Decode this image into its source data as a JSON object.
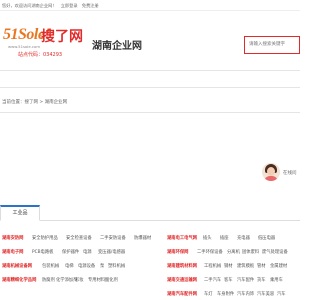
{
  "topbar": {
    "welcome": "您好，欢迎访问湖南企业网！",
    "login": "立即登录",
    "register": "免费注册"
  },
  "logo": {
    "brand": "51Sole!",
    "soso": "搜了网",
    "url": "www.51sole.com",
    "code_label": "站点代码：034293"
  },
  "site_title": "湖南企业网",
  "search": {
    "placeholder": "请输入搜索关键字"
  },
  "breadcrumb": "当前位置：搜了网 > 湖南企业网",
  "chat": {
    "label": "在线问"
  },
  "tabs": [
    {
      "label": "工业品"
    }
  ],
  "categories": [
    {
      "title": "湖南安防网",
      "items": [
        "安全防护用品",
        "安全检查设备",
        "二手安防设备",
        "防爆器材"
      ]
    },
    {
      "title": "湖南电子网",
      "items": [
        "PCB电路板",
        "保护器件",
        "电源",
        "变压器/电感器"
      ]
    },
    {
      "title": "湖南机械设备网",
      "items": [
        "包装机械",
        "电梯",
        "电源设备",
        "泵",
        "塑料机械"
      ]
    },
    {
      "title": "湖南精细化学品网",
      "items": [
        "防腐剂",
        "化学添加剂",
        "彩妆",
        "专用材料",
        "酸化剂"
      ]
    }
  ],
  "categories_right": [
    {
      "title": "湖南电工电气网",
      "items": [
        "插头",
        "插座",
        "充电器",
        "低压电器"
      ]
    },
    {
      "title": "湖南环保网",
      "items": [
        "二手环保设备",
        "分离机",
        "固体废料",
        "废气处理设备"
      ]
    },
    {
      "title": "湖南建筑材料网",
      "items": [
        "工程机械",
        "钢材",
        "建筑模板",
        "管材",
        "金属建材"
      ]
    },
    {
      "title": "湖南交通运输网",
      "items": [
        "二手汽车",
        "客车",
        "汽车配件",
        "货车",
        "乘用车"
      ]
    },
    {
      "title": "湖南汽车配件网",
      "items": [
        "车灯",
        "车身附件",
        "汽车内饰",
        "汽车美容",
        "汽车"
      ]
    }
  ]
}
